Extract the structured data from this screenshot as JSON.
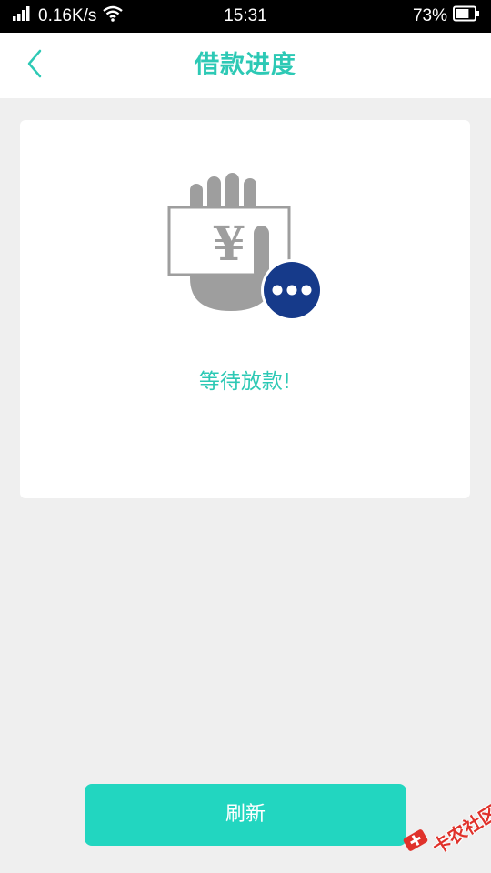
{
  "status_bar": {
    "network_speed": "0.16K/s",
    "time": "15:31",
    "battery": "73%",
    "battery_level": 0.73,
    "icons": [
      "signal-icon",
      "wifi-icon",
      "battery-icon"
    ]
  },
  "header": {
    "title": "借款进度",
    "back_icon": "chevron-left-icon"
  },
  "card": {
    "illustration_icon": "hand-holding-money-icon",
    "currency_symbol": "¥",
    "status_text": "等待放款!"
  },
  "refresh_button": {
    "label": "刷新"
  },
  "watermark": {
    "text": "卡农社区"
  },
  "colors": {
    "accent": "#2dc9b5",
    "button": "#22d6c0",
    "pending_badge": "#163a8a",
    "illustration_gray": "#9e9e9e",
    "background": "#efefef"
  }
}
